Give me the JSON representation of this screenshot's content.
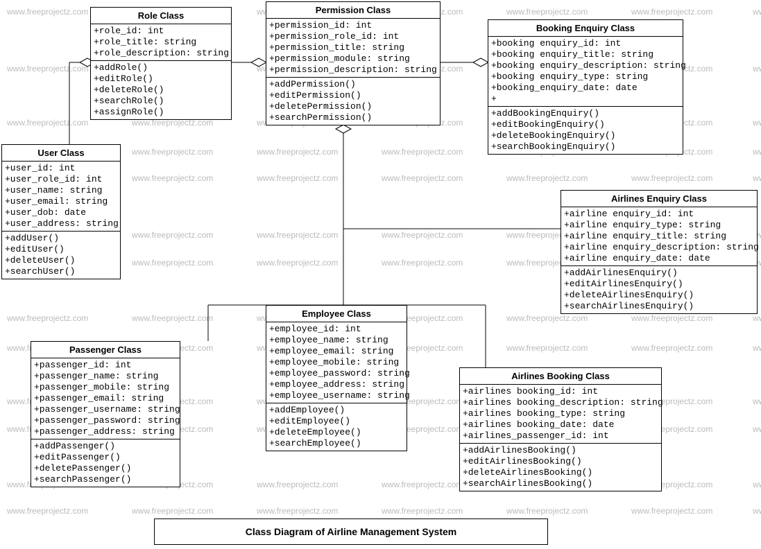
{
  "watermark_text": "www.freeprojectz.com",
  "caption": "Class Diagram of Airline Management System",
  "classes": {
    "role": {
      "title": "Role Class",
      "attrs": [
        "+role_id: int",
        "+role_title: string",
        "+role_description: string"
      ],
      "ops": [
        "+addRole()",
        "+editRole()",
        "+deleteRole()",
        "+searchRole()",
        "+assignRole()"
      ]
    },
    "permission": {
      "title": "Permission Class",
      "attrs": [
        "+permission_id: int",
        "+permission_role_id: int",
        "+permission_title: string",
        "+permission_module: string",
        "+permission_description: string"
      ],
      "ops": [
        "+addPermission()",
        "+editPermission()",
        "+deletePermission()",
        "+searchPermission()"
      ]
    },
    "bookingEnquiry": {
      "title": "Booking Enquiry Class",
      "attrs": [
        "+booking enquiry_id: int",
        "+booking enquiry_title: string",
        "+booking enquiry_description: string",
        "+booking enquiry_type: string",
        "+booking_enquiry_date: date",
        "+"
      ],
      "ops": [
        "+addBookingEnquiry()",
        "+editBookingEnquiry()",
        "+deleteBookingEnquiry()",
        "+searchBookingEnquiry()"
      ]
    },
    "user": {
      "title": "User Class",
      "attrs": [
        "+user_id: int",
        "+user_role_id: int",
        "+user_name: string",
        "+user_email: string",
        "+user_dob: date",
        "+user_address: string"
      ],
      "ops": [
        "+addUser()",
        "+editUser()",
        "+deleteUser()",
        "+searchUser()"
      ]
    },
    "airlinesEnquiry": {
      "title": "Airlines Enquiry Class",
      "attrs": [
        "+airline enquiry_id: int",
        "+airline enquiry_type: string",
        "+airline enquiry_title: string",
        "+airline enquiry_description: string",
        "+airline enquiry_date: date"
      ],
      "ops": [
        "+addAirlinesEnquiry()",
        "+editAirlinesEnquiry()",
        "+deleteAirlinesEnquiry()",
        "+searchAirlinesEnquiry()"
      ]
    },
    "employee": {
      "title": "Employee Class",
      "attrs": [
        "+employee_id: int",
        "+employee_name: string",
        "+employee_email: string",
        "+employee_mobile: string",
        "+employee_password: string",
        "+employee_address: string",
        "+employee_username: string"
      ],
      "ops": [
        "+addEmployee()",
        "+editEmployee()",
        "+deleteEmployee()",
        "+searchEmployee()"
      ]
    },
    "passenger": {
      "title": "Passenger Class",
      "attrs": [
        "+passenger_id: int",
        "+passenger_name: string",
        "+passenger_mobile: string",
        "+passenger_email: string",
        "+passenger_username: string",
        "+passenger_password: string",
        "+passenger_address: string"
      ],
      "ops": [
        "+addPassenger()",
        "+editPassenger()",
        "+deletePassenger()",
        "+searchPassenger()"
      ]
    },
    "airlinesBooking": {
      "title": "Airlines Booking Class",
      "attrs": [
        "+airlines booking_id: int",
        "+airlines booking_description: string",
        "+airlines booking_type: string",
        "+airlines booking_date: date",
        "+airlines_passenger_id: int"
      ],
      "ops": [
        "+addAirlinesBooking()",
        "+editAirlinesBooking()",
        "+deleteAirlinesBooking()",
        "+searchAirlinesBooking()"
      ]
    }
  }
}
